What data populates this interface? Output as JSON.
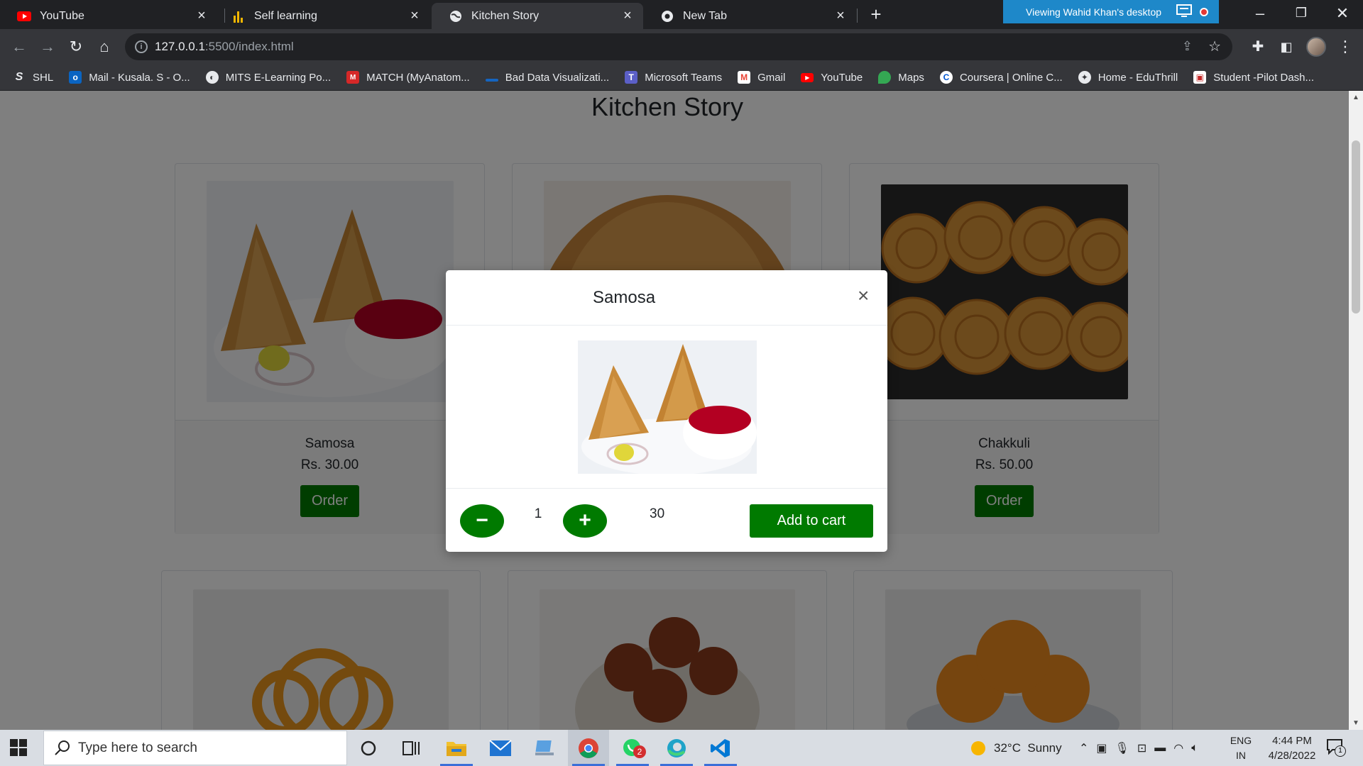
{
  "browser": {
    "tabs": [
      {
        "title": "YouTube",
        "icon": "youtube-icon"
      },
      {
        "title": "Self learning",
        "icon": "chart-icon"
      },
      {
        "title": "Kitchen Story",
        "icon": "globe-icon",
        "active": true
      },
      {
        "title": "New Tab",
        "icon": "chrome-icon"
      }
    ],
    "viewing_banner": "Viewing Wahid Khan's desktop",
    "url_host": "127.0.0.1",
    "url_path": ":5500/index.html",
    "bookmarks": [
      {
        "label": "SHL",
        "icon": "shl-icon"
      },
      {
        "label": "Mail - Kusala. S - O...",
        "icon": "outlook-icon"
      },
      {
        "label": "MITS E-Learning Po...",
        "icon": "globe-icon"
      },
      {
        "label": "MATCH (MyAnatom...",
        "icon": "match-icon"
      },
      {
        "label": "Bad Data Visualizati...",
        "icon": "bookmark-icon"
      },
      {
        "label": "Microsoft Teams",
        "icon": "teams-icon"
      },
      {
        "label": "Gmail",
        "icon": "gmail-icon"
      },
      {
        "label": "YouTube",
        "icon": "youtube-icon"
      },
      {
        "label": "Maps",
        "icon": "maps-icon"
      },
      {
        "label": "Coursera | Online C...",
        "icon": "coursera-icon"
      },
      {
        "label": "Home - EduThrill",
        "icon": "eduthrill-icon"
      },
      {
        "label": "Student -Pilot Dash...",
        "icon": "student-icon"
      }
    ]
  },
  "page": {
    "title": "Kitchen Story",
    "products": [
      {
        "name": "Samosa",
        "price": "Rs. 30.00",
        "order_label": "Order"
      },
      {
        "name": "",
        "price": "",
        "order_label": ""
      },
      {
        "name": "Chakkuli",
        "price": "Rs. 50.00",
        "order_label": "Order"
      }
    ]
  },
  "modal": {
    "title": "Samosa",
    "close": "×",
    "minus": "−",
    "plus": "+",
    "quantity": "1",
    "total": "30",
    "add_to_cart": "Add to cart"
  },
  "taskbar": {
    "search_placeholder": "Type here to search",
    "weather": "32°C  Sunny",
    "lang_top": "ENG",
    "lang_bottom": "IN",
    "time": "4:44 PM",
    "date": "4/28/2022",
    "whatsapp_badge": "2",
    "notification_count": "1"
  },
  "colors": {
    "accent_green": "#007a00",
    "chrome_dark": "#202124",
    "chrome_toolbar": "#35363a",
    "viewing_banner": "#1e88c9"
  }
}
